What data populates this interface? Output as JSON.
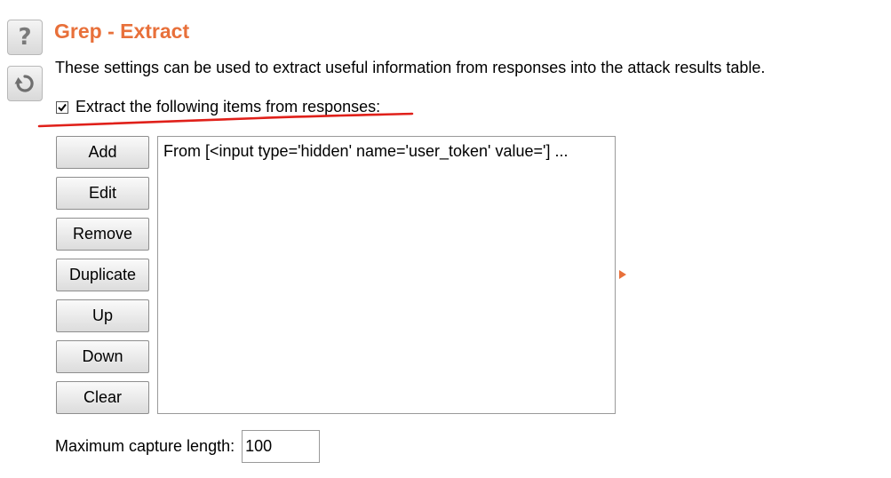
{
  "sidebar": {
    "help_glyph": "?",
    "help_icon": "help-icon",
    "reset_icon": "reset-icon"
  },
  "section": {
    "title": "Grep - Extract",
    "description": "These settings can be used to extract useful information from responses into the attack results table.",
    "title_color": "#e8703a"
  },
  "extract": {
    "checkbox_checked": true,
    "checkbox_label": "Extract the following items from responses:",
    "annotation_color": "#e0201a"
  },
  "buttons": {
    "add": "Add",
    "edit": "Edit",
    "remove": "Remove",
    "duplicate": "Duplicate",
    "up": "Up",
    "down": "Down",
    "clear": "Clear"
  },
  "items": [
    "From [<input type='hidden' name='user_token' value='] ..."
  ],
  "capture": {
    "label": "Maximum capture length:",
    "value": "100"
  }
}
